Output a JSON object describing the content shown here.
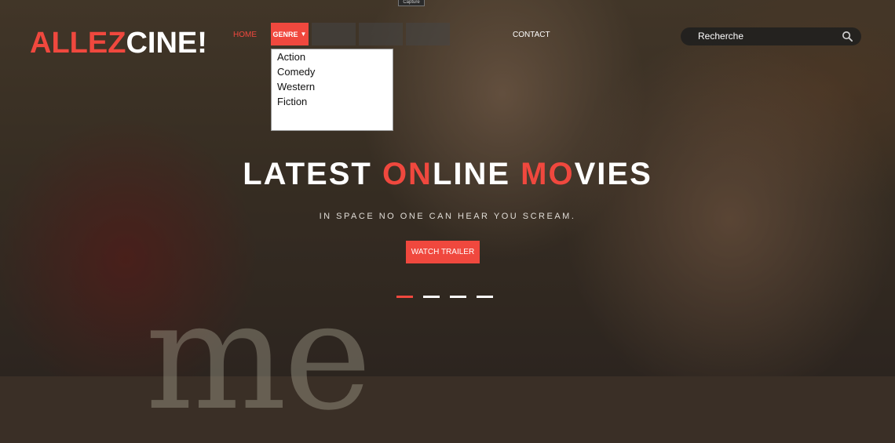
{
  "top_tag": "Capture",
  "logo": {
    "part1": "ALLEZ",
    "part2": "CINE!"
  },
  "nav": {
    "home": "HOME",
    "genre": "GENRE",
    "genre_arrow": "▼",
    "contact": "CONTACT"
  },
  "genre_dropdown": {
    "options": [
      "Action",
      "Comedy",
      "Western",
      "Fiction"
    ]
  },
  "search": {
    "placeholder": "Recherche",
    "icon": "search-icon"
  },
  "hero": {
    "title_parts": [
      "LATEST ",
      "ON",
      "LINE ",
      "MO",
      "VIES"
    ],
    "subtitle": "IN SPACE NO ONE CAN HEAR YOU SCREAM.",
    "button": "WATCH TRAILER",
    "watermark": "me",
    "slides": 4,
    "active_slide": 1
  },
  "colors": {
    "accent": "#f0483e",
    "text": "#ffffff"
  }
}
